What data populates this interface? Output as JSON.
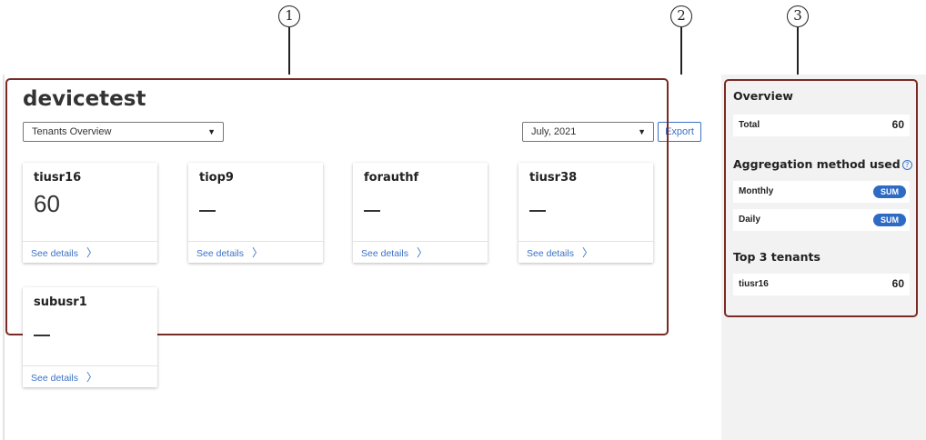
{
  "callouts": [
    "1",
    "2",
    "3"
  ],
  "page": {
    "title": "devicetest"
  },
  "toolbar": {
    "view_select": "Tenants Overview",
    "date_select": "July, 2021",
    "export_label": "Export"
  },
  "tenant_cards": [
    {
      "name": "tiusr16",
      "value": "60",
      "details_label": "See details"
    },
    {
      "name": "tiop9",
      "value": null,
      "details_label": "See details"
    },
    {
      "name": "forauthf",
      "value": null,
      "details_label": "See details"
    },
    {
      "name": "tiusr38",
      "value": null,
      "details_label": "See details"
    },
    {
      "name": "subusr1",
      "value": null,
      "details_label": "See details"
    }
  ],
  "sidebar": {
    "overview_heading": "Overview",
    "total_label": "Total",
    "total_value": "60",
    "aggregation_heading": "Aggregation method used",
    "aggregation_rows": [
      {
        "label": "Monthly",
        "badge": "SUM"
      },
      {
        "label": "Daily",
        "badge": "SUM"
      }
    ],
    "top_heading": "Top 3 tenants",
    "top_tenants": [
      {
        "name": "tiusr16",
        "value": "60"
      }
    ]
  },
  "colors": {
    "accent": "#3a72c6",
    "badge": "#2f6bc4",
    "callout_outline": "#7a2a25",
    "sidebar_bg": "#f2f2f2"
  },
  "icons": [
    "caret-down-icon",
    "chevron-right-icon",
    "help-circle-icon"
  ]
}
